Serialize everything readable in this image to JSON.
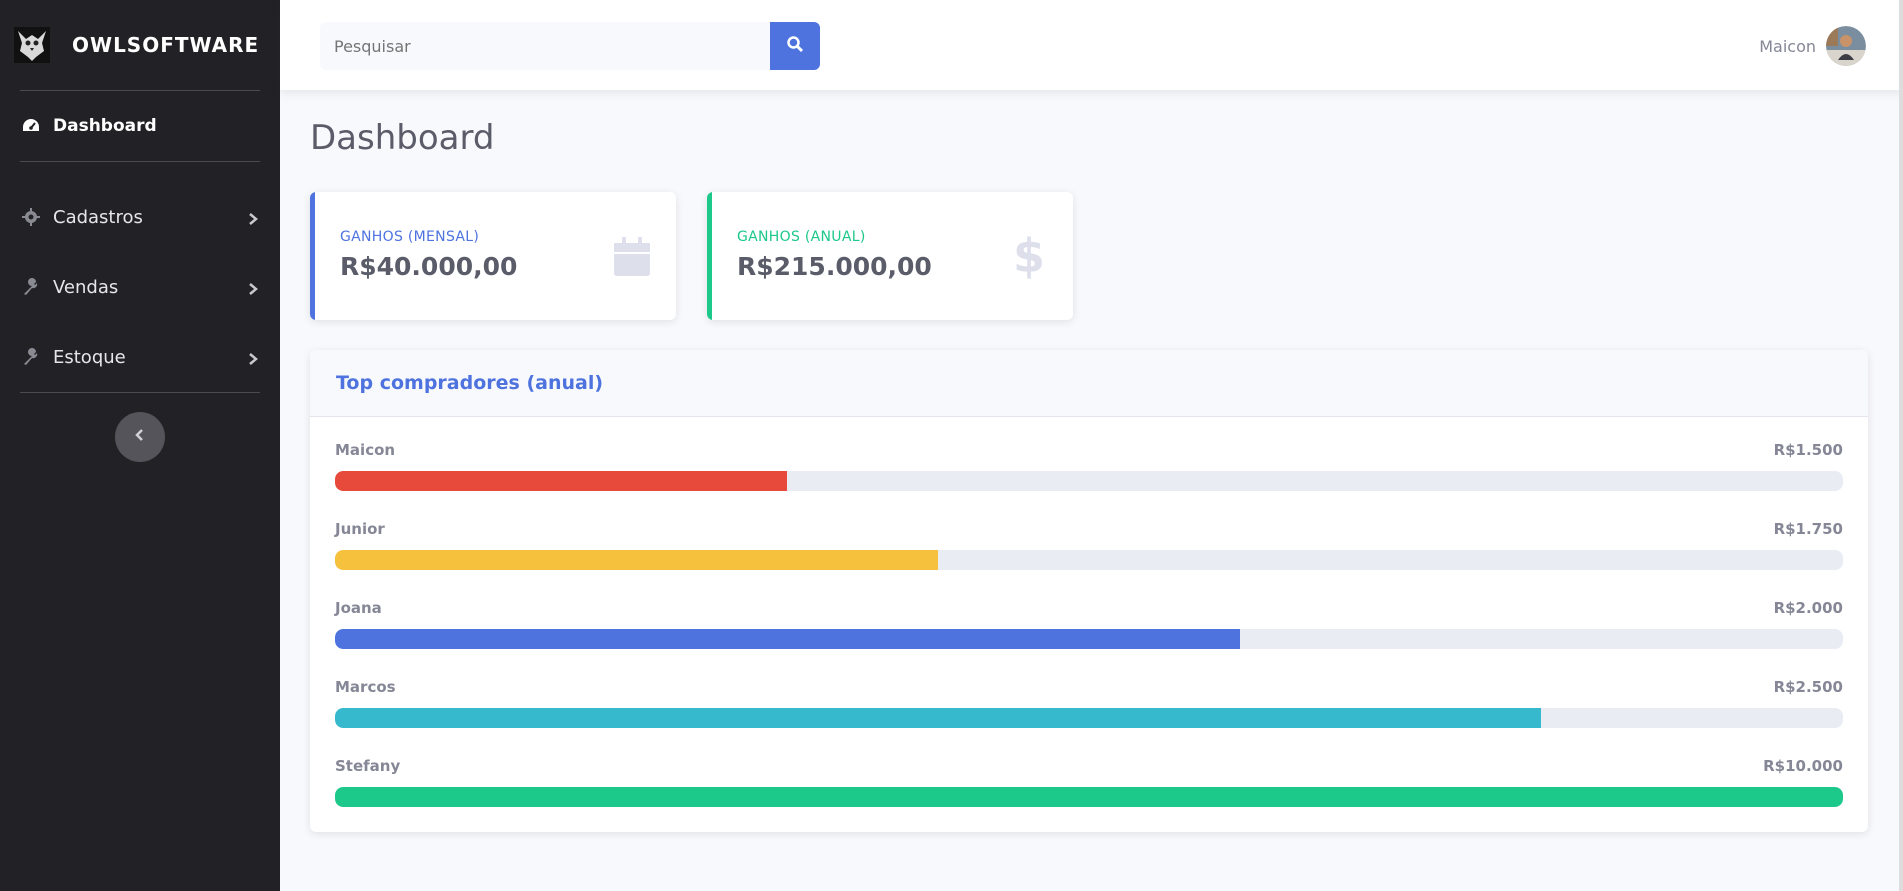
{
  "brand": {
    "name": "OWLSOFTWARE",
    "logo": "owl-logo"
  },
  "sidebar": {
    "items": [
      {
        "label": "Dashboard",
        "icon": "tachometer-icon",
        "active": true
      },
      {
        "label": "Cadastros",
        "icon": "gear-icon"
      },
      {
        "label": "Vendas",
        "icon": "wrench-icon"
      },
      {
        "label": "Estoque",
        "icon": "wrench-icon"
      }
    ],
    "toggle_icon": "chevron-left-icon"
  },
  "topbar": {
    "search": {
      "placeholder": "Pesquisar",
      "value": ""
    },
    "user": {
      "name": "Maicon"
    }
  },
  "page": {
    "title": "Dashboard"
  },
  "stats": [
    {
      "label": "GANHOS (MENSAL)",
      "value": "R$40.000,00",
      "icon": "calendar-icon",
      "color": "#4e73df"
    },
    {
      "label": "GANHOS (ANUAL)",
      "value": "R$215.000,00",
      "icon": "dollar-icon",
      "color": "#1cc88a"
    }
  ],
  "top_buyers": {
    "title": "Top compradores (anual)",
    "rows": [
      {
        "name": "Maicon",
        "amount": "R$1.500",
        "percent": 30,
        "color": "#e74a3b"
      },
      {
        "name": "Junior",
        "amount": "R$1.750",
        "percent": 40,
        "color": "#f6c23e"
      },
      {
        "name": "Joana",
        "amount": "R$2.000",
        "percent": 60,
        "color": "#4e73df"
      },
      {
        "name": "Marcos",
        "amount": "R$2.500",
        "percent": 80,
        "color": "#36b9cc"
      },
      {
        "name": "Stefany",
        "amount": "R$10.000",
        "percent": 100,
        "color": "#1cc88a"
      }
    ]
  }
}
